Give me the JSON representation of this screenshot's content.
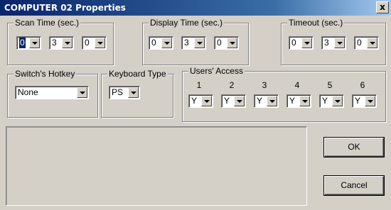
{
  "window": {
    "title": "COMPUTER 02 Properties",
    "close_glyph": "x"
  },
  "scan_time": {
    "label": "Scan Time (sec.)",
    "values": [
      "0",
      "3",
      "0"
    ]
  },
  "display_time": {
    "label": "Display Time (sec.)",
    "values": [
      "0",
      "3",
      "0"
    ]
  },
  "timeout": {
    "label": "Timeout (sec.)",
    "values": [
      "0",
      "3",
      "0"
    ]
  },
  "hotkey": {
    "label": "Switch's Hotkey",
    "value": "None"
  },
  "keyboard": {
    "label": "Keyboard Type",
    "value": "PS"
  },
  "users_access": {
    "label": "Users' Access",
    "users": [
      {
        "num": "1",
        "value": "Y"
      },
      {
        "num": "2",
        "value": "Y"
      },
      {
        "num": "3",
        "value": "Y"
      },
      {
        "num": "4",
        "value": "Y"
      },
      {
        "num": "5",
        "value": "Y"
      },
      {
        "num": "6",
        "value": "Y"
      }
    ]
  },
  "buttons": {
    "ok": "OK",
    "cancel": "Cancel"
  }
}
